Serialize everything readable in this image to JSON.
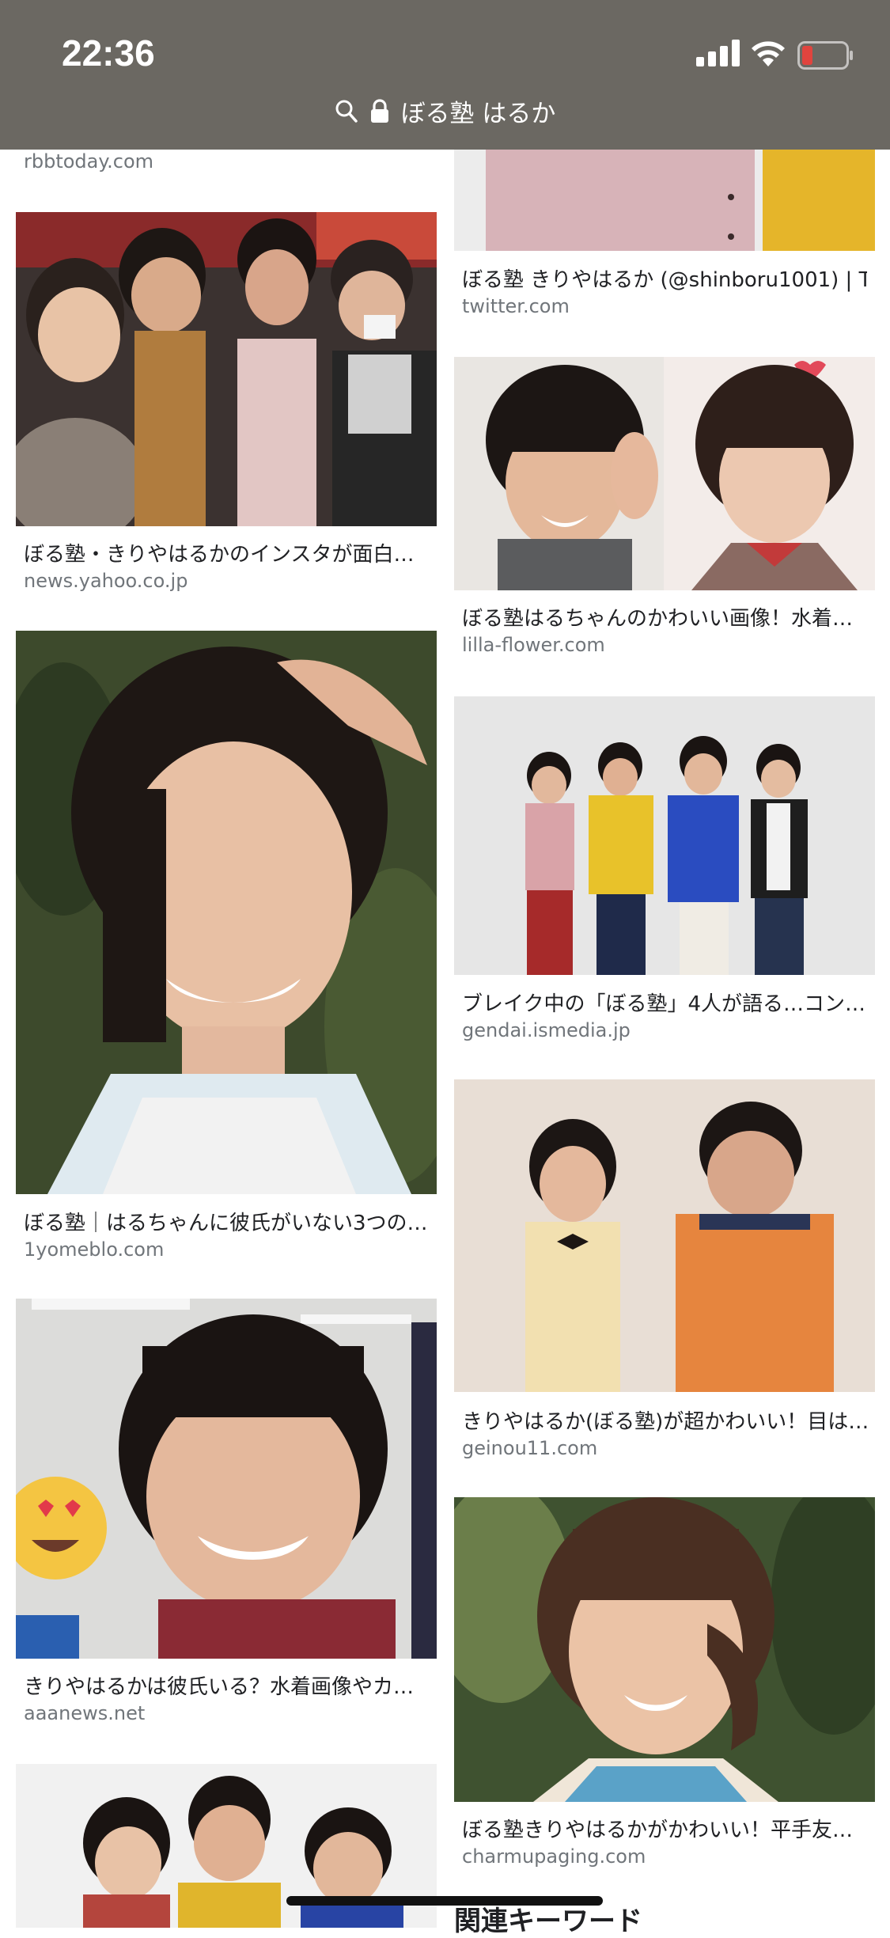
{
  "status": {
    "time": "22:36"
  },
  "urlbar": {
    "query": "ぼる塾 はるか"
  },
  "left": [
    {
      "source": "rbbtoday.com"
    },
    {
      "title": "ぼる塾・きりやはるかのインスタが面白…",
      "source": "news.yahoo.co.jp"
    },
    {
      "title": "ぼる塾｜はるちゃんに彼氏がいない3つの…",
      "source": "1yomeblo.com"
    },
    {
      "title": "きりやはるかは彼氏いる？水着画像やカ…",
      "source": "aaanews.net"
    }
  ],
  "right": [
    {
      "title": "ぼる塾 きりやはるか (@shinboru1001) | T…",
      "source": "twitter.com"
    },
    {
      "title": "ぼる塾はるちゃんのかわいい画像！水着…",
      "source": "lilla-flower.com"
    },
    {
      "title": "ブレイク中の「ぼる塾」4人が語る…コン…",
      "source": "gendai.ismedia.jp"
    },
    {
      "title": "きりやはるか(ぼる塾)が超かわいい！目は…",
      "source": "geinou11.com"
    },
    {
      "title": "ぼる塾きりやはるかがかわいい！平手友…",
      "source": "charmupaging.com"
    }
  ],
  "related_heading": "関連キーワード",
  "colors": {
    "status_bg": "#6b6862",
    "title": "#202124",
    "source": "#70757a",
    "battery_low": "#e0443e"
  },
  "icons": [
    "search-icon",
    "lock-icon",
    "signal-icon",
    "wifi-icon",
    "battery-icon"
  ]
}
